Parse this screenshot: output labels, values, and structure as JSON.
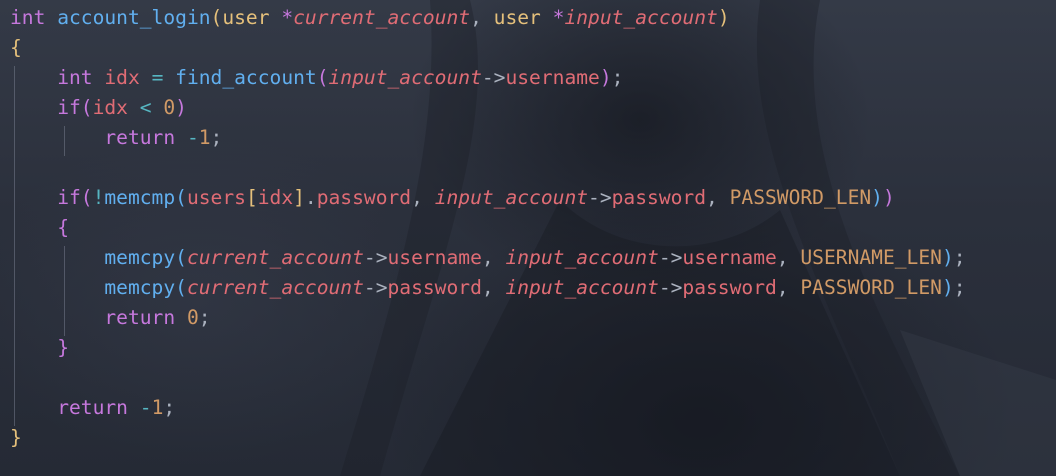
{
  "editor": {
    "lines": [
      {
        "tokens": [
          {
            "t": "int",
            "c": "kw"
          },
          {
            "t": " ",
            "c": "punc"
          },
          {
            "t": "account_login",
            "c": "fn"
          },
          {
            "t": "(",
            "c": "br1"
          },
          {
            "t": "user",
            "c": "type"
          },
          {
            "t": " ",
            "c": "punc"
          },
          {
            "t": "*",
            "c": "kw"
          },
          {
            "t": "current_account",
            "c": "param"
          },
          {
            "t": ", ",
            "c": "punc"
          },
          {
            "t": "user",
            "c": "type"
          },
          {
            "t": " ",
            "c": "punc"
          },
          {
            "t": "*",
            "c": "kw"
          },
          {
            "t": "input_account",
            "c": "param"
          },
          {
            "t": ")",
            "c": "br1"
          }
        ]
      },
      {
        "tokens": [
          {
            "t": "{",
            "c": "br1"
          }
        ]
      },
      {
        "tokens": [
          {
            "t": "    ",
            "c": "punc"
          },
          {
            "t": "int",
            "c": "kw"
          },
          {
            "t": " ",
            "c": "punc"
          },
          {
            "t": "idx",
            "c": "var"
          },
          {
            "t": " ",
            "c": "punc"
          },
          {
            "t": "=",
            "c": "op"
          },
          {
            "t": " ",
            "c": "punc"
          },
          {
            "t": "find_account",
            "c": "fn"
          },
          {
            "t": "(",
            "c": "br2"
          },
          {
            "t": "input_account",
            "c": "param"
          },
          {
            "t": "->",
            "c": "punc"
          },
          {
            "t": "username",
            "c": "var"
          },
          {
            "t": ")",
            "c": "br2"
          },
          {
            "t": ";",
            "c": "punc"
          }
        ]
      },
      {
        "tokens": [
          {
            "t": "    ",
            "c": "punc"
          },
          {
            "t": "if",
            "c": "kw"
          },
          {
            "t": "(",
            "c": "br2"
          },
          {
            "t": "idx",
            "c": "var"
          },
          {
            "t": " ",
            "c": "punc"
          },
          {
            "t": "<",
            "c": "op"
          },
          {
            "t": " ",
            "c": "punc"
          },
          {
            "t": "0",
            "c": "num"
          },
          {
            "t": ")",
            "c": "br2"
          }
        ]
      },
      {
        "tokens": [
          {
            "t": "        ",
            "c": "punc"
          },
          {
            "t": "return",
            "c": "kw"
          },
          {
            "t": " ",
            "c": "punc"
          },
          {
            "t": "-",
            "c": "op"
          },
          {
            "t": "1",
            "c": "num"
          },
          {
            "t": ";",
            "c": "punc"
          }
        ]
      },
      {
        "tokens": []
      },
      {
        "tokens": [
          {
            "t": "    ",
            "c": "punc"
          },
          {
            "t": "if",
            "c": "kw"
          },
          {
            "t": "(",
            "c": "br2"
          },
          {
            "t": "!",
            "c": "op"
          },
          {
            "t": "memcmp",
            "c": "fn"
          },
          {
            "t": "(",
            "c": "br3"
          },
          {
            "t": "users",
            "c": "var"
          },
          {
            "t": "[",
            "c": "br1"
          },
          {
            "t": "idx",
            "c": "var"
          },
          {
            "t": "]",
            "c": "br1"
          },
          {
            "t": ".",
            "c": "punc"
          },
          {
            "t": "password",
            "c": "var"
          },
          {
            "t": ", ",
            "c": "punc"
          },
          {
            "t": "input_account",
            "c": "param"
          },
          {
            "t": "->",
            "c": "punc"
          },
          {
            "t": "password",
            "c": "var"
          },
          {
            "t": ", ",
            "c": "punc"
          },
          {
            "t": "PASSWORD_LEN",
            "c": "const"
          },
          {
            "t": ")",
            "c": "br3"
          },
          {
            "t": ")",
            "c": "br2"
          }
        ]
      },
      {
        "tokens": [
          {
            "t": "    ",
            "c": "punc"
          },
          {
            "t": "{",
            "c": "br2"
          }
        ]
      },
      {
        "tokens": [
          {
            "t": "        ",
            "c": "punc"
          },
          {
            "t": "memcpy",
            "c": "fn"
          },
          {
            "t": "(",
            "c": "br3"
          },
          {
            "t": "current_account",
            "c": "param"
          },
          {
            "t": "->",
            "c": "punc"
          },
          {
            "t": "username",
            "c": "var"
          },
          {
            "t": ", ",
            "c": "punc"
          },
          {
            "t": "input_account",
            "c": "param"
          },
          {
            "t": "->",
            "c": "punc"
          },
          {
            "t": "username",
            "c": "var"
          },
          {
            "t": ", ",
            "c": "punc"
          },
          {
            "t": "USERNAME_LEN",
            "c": "const"
          },
          {
            "t": ")",
            "c": "br3"
          },
          {
            "t": ";",
            "c": "punc"
          }
        ]
      },
      {
        "tokens": [
          {
            "t": "        ",
            "c": "punc"
          },
          {
            "t": "memcpy",
            "c": "fn"
          },
          {
            "t": "(",
            "c": "br3"
          },
          {
            "t": "current_account",
            "c": "param"
          },
          {
            "t": "->",
            "c": "punc"
          },
          {
            "t": "password",
            "c": "var"
          },
          {
            "t": ", ",
            "c": "punc"
          },
          {
            "t": "input_account",
            "c": "param"
          },
          {
            "t": "->",
            "c": "punc"
          },
          {
            "t": "password",
            "c": "var"
          },
          {
            "t": ", ",
            "c": "punc"
          },
          {
            "t": "PASSWORD_LEN",
            "c": "const"
          },
          {
            "t": ")",
            "c": "br3"
          },
          {
            "t": ";",
            "c": "punc"
          }
        ]
      },
      {
        "tokens": [
          {
            "t": "        ",
            "c": "punc"
          },
          {
            "t": "return",
            "c": "kw"
          },
          {
            "t": " ",
            "c": "punc"
          },
          {
            "t": "0",
            "c": "num"
          },
          {
            "t": ";",
            "c": "punc"
          }
        ]
      },
      {
        "tokens": [
          {
            "t": "    ",
            "c": "punc"
          },
          {
            "t": "}",
            "c": "br2"
          }
        ]
      },
      {
        "tokens": []
      },
      {
        "tokens": [
          {
            "t": "    ",
            "c": "punc"
          },
          {
            "t": "return",
            "c": "kw"
          },
          {
            "t": " ",
            "c": "punc"
          },
          {
            "t": "-",
            "c": "op"
          },
          {
            "t": "1",
            "c": "num"
          },
          {
            "t": ";",
            "c": "punc"
          }
        ]
      },
      {
        "tokens": [
          {
            "t": "}",
            "c": "br1"
          }
        ]
      }
    ]
  },
  "colors": {
    "background": "#2a2f3b",
    "keyword": "#c678dd",
    "type": "#e5c07b",
    "function": "#61afef",
    "parameter": "#e06c75",
    "number": "#d19a66",
    "operator": "#56b6c2",
    "text": "#abb2bf"
  }
}
